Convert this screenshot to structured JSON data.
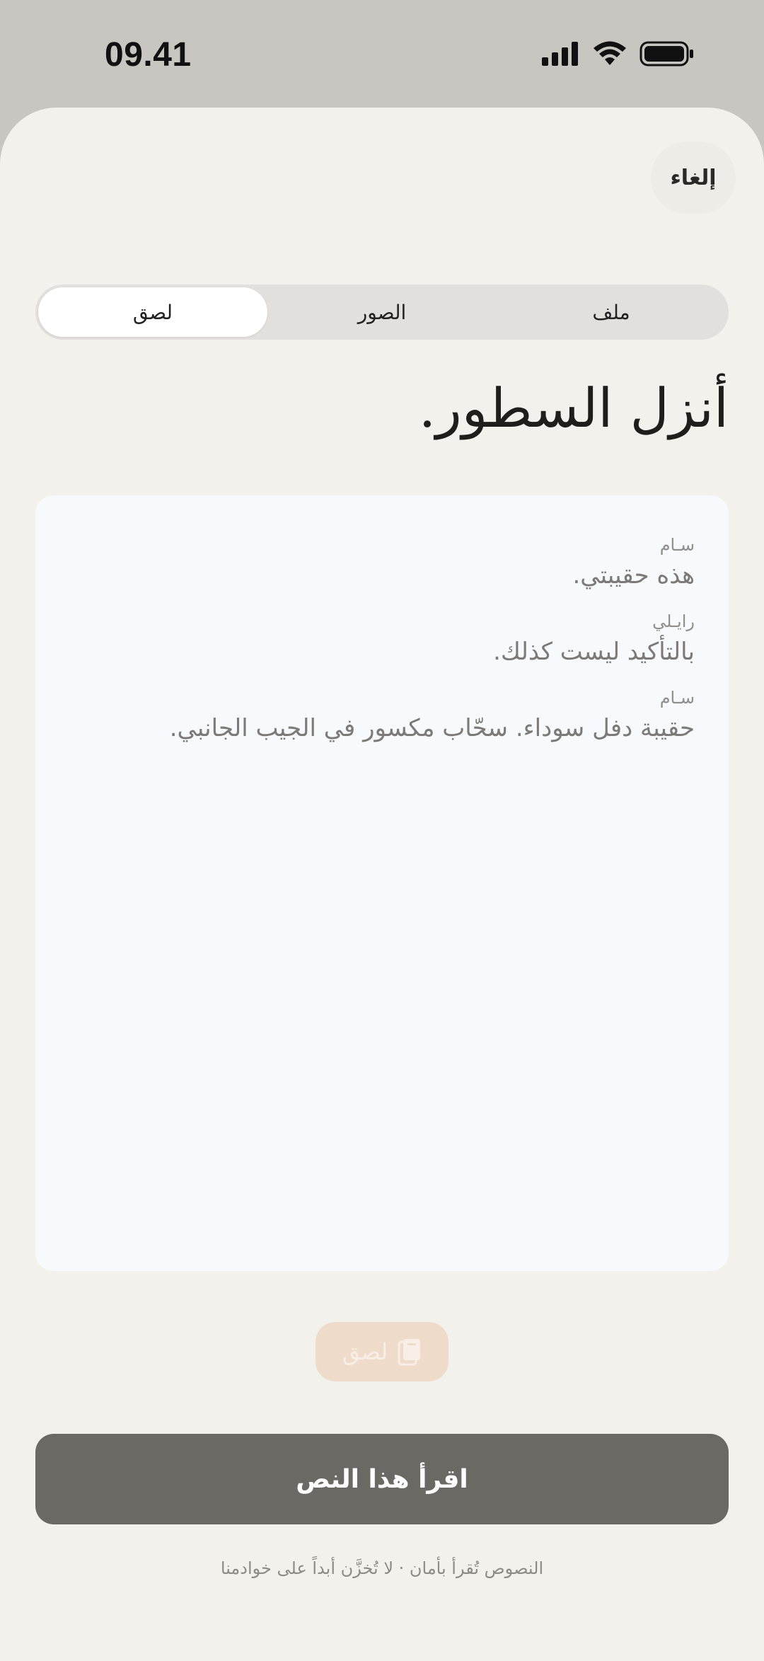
{
  "status_bar": {
    "time": "09.41",
    "icons": [
      "signal-icon",
      "wifi-icon",
      "battery-icon"
    ]
  },
  "header": {
    "cancel_label": "إلغاء"
  },
  "tabs": [
    {
      "label": "ملف",
      "active": false
    },
    {
      "label": "الصور",
      "active": false
    },
    {
      "label": "لصق",
      "active": true
    }
  ],
  "title": "أنزل السطور.",
  "script_lines": [
    {
      "speaker": "سـام",
      "text": "هذه حقيبتي."
    },
    {
      "speaker": "رايـلي",
      "text": "بالتأكيد ليست كذلك."
    },
    {
      "speaker": "سـام",
      "text": "حقيبة دفل سوداء. سحّاب مكسور في الجيب الجانبي."
    }
  ],
  "paste_button": {
    "label": "لصق",
    "icon": "clipboard-icon"
  },
  "primary_button": {
    "label": "اقرأ هذا النص"
  },
  "footnote": "النصوص تُقرأ بأمان · لا تُخزَّن أبداً على خوادمنا",
  "colors": {
    "sheet_bg": "#f3f1ec",
    "primary_button": "#6b6963",
    "paste_chip": "#efdbca"
  }
}
